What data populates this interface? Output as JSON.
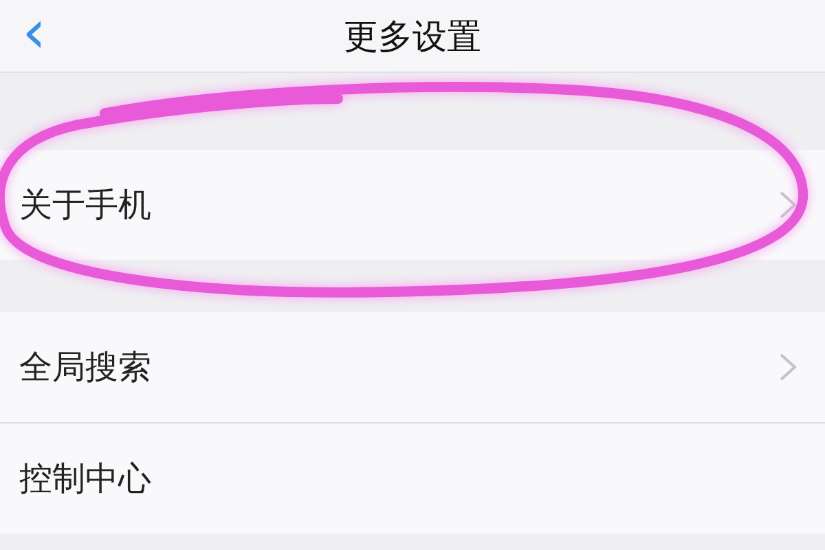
{
  "header": {
    "title": "更多设置",
    "back": "‹"
  },
  "groups": [
    {
      "items": [
        {
          "label": "关于手机",
          "chevron": true,
          "annotated": true
        }
      ]
    },
    {
      "items": [
        {
          "label": "全局搜索",
          "chevron": true,
          "annotated": false
        },
        {
          "label": "控制中心",
          "chevron": false,
          "annotated": false
        }
      ]
    }
  ]
}
